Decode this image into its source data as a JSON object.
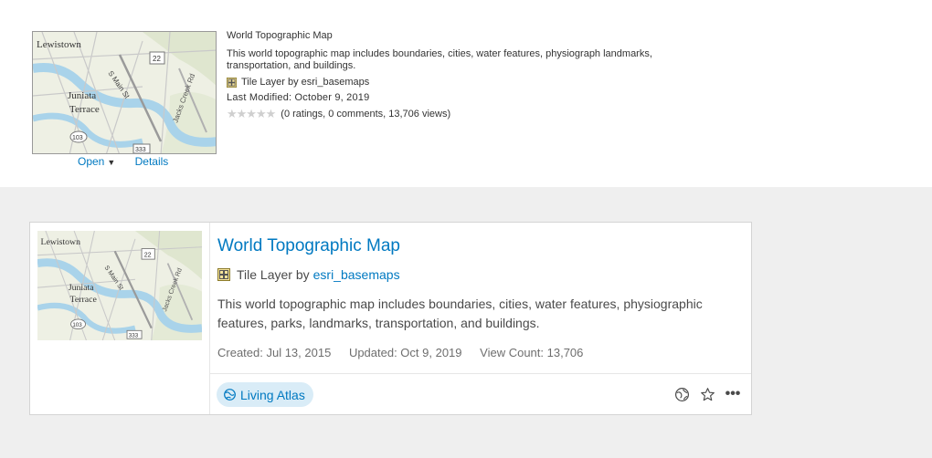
{
  "compact_item": {
    "thumbnail_labels": [
      "Lewistown",
      "Juniata",
      "Terrace",
      "S Main St",
      "Jacks Creek Rd",
      "22",
      "103",
      "333"
    ],
    "open_label": "Open",
    "open_caret": "▼",
    "details_label": "Details",
    "title": "World Topographic Map",
    "description": "This world topographic map includes boundaries, cities, water features, physiograph landmarks, transportation, and buildings.",
    "layer_type": "Tile Layer by",
    "owner": "esri_basemaps",
    "last_modified": "Last Modified: October 9, 2019",
    "stars": "★★★★★",
    "ratings_summary": "(0 ratings, 0 comments, 13,706 views)"
  },
  "card_item": {
    "thumbnail_labels": [
      "Lewistown",
      "Juniata",
      "Terrace",
      "S Main St",
      "Jacks Creek Rd",
      "22",
      "103",
      "333"
    ],
    "title": "World Topographic Map",
    "layer_type": "Tile Layer by",
    "owner": "esri_basemaps",
    "description": "This world topographic map includes boundaries, cities, water features, physiographic features, parks, landmarks, transportation, and buildings.",
    "created": "Created: Jul 13, 2015",
    "updated": "Updated: Oct 9, 2019",
    "view_count": "View Count: 13,706",
    "badge_label": "Living Atlas",
    "actions": [
      "globe-icon",
      "star-icon",
      "more-icon"
    ],
    "more_glyph": "•••"
  },
  "colors": {
    "link": "#0079c1",
    "badge_bg": "#d9ecf7",
    "panel_bg": "#efefef"
  }
}
